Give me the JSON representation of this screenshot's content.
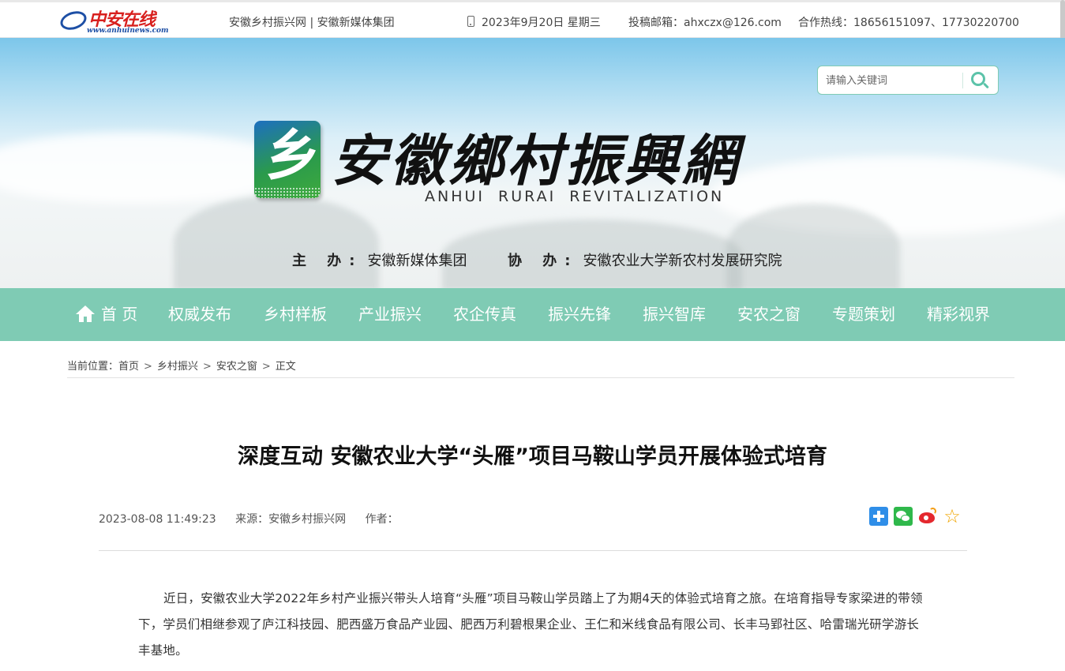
{
  "topbar": {
    "logo_brand": "中安在线",
    "logo_url": "www.anhuinews.com",
    "site_links": "安徽乡村振兴网 | 安徽新媒体集团",
    "date": "2023年9月20日 星期三",
    "email": "投稿邮箱：ahxczx@126.com",
    "hotline": "合作热线：18656151097、17730220700"
  },
  "banner": {
    "emblem_glyph": "乡",
    "title": "安徽鄉村振興網",
    "subtitle": "ANHUI RURAI REVITALIZATION",
    "host_label": "主 办:",
    "host_value": "安徽新媒体集团",
    "co_label": "协 办:",
    "co_value": "安徽农业大学新农村发展研究院",
    "search_placeholder": "请输入关键词"
  },
  "nav": {
    "items": [
      "首 页",
      "权威发布",
      "乡村样板",
      "产业振兴",
      "农企传真",
      "振兴先锋",
      "振兴智库",
      "安农之窗",
      "专题策划",
      "精彩视界"
    ]
  },
  "breadcrumb": {
    "label": "当前位置：",
    "items": [
      "首页",
      "乡村振兴",
      "安农之窗",
      "正文"
    ]
  },
  "article": {
    "title": "深度互动 安徽农业大学“头雁”项目马鞍山学员开展体验式培育",
    "datetime": "2023-08-08 11:49:23",
    "source": "来源：安徽乡村振兴网",
    "author": "作者：",
    "share_icons": [
      "share-plus-icon",
      "wechat-icon",
      "weibo-icon",
      "favorite-star-icon"
    ],
    "paragraph": "近日，安徽农业大学2022年乡村产业振兴带头人培育“头雁”项目马鞍山学员踏上了为期4天的体验式培育之旅。在培育指导专家梁进的带领下，学员们相继参观了庐江科技园、肥西盛万食品产业园、肥西万利碧根果企业、王仁和米线食品有限公司、长丰马郢社区、哈雷瑞光研学游长丰基地。"
  },
  "colors": {
    "nav_bg": "#7fcbb4",
    "accent": "#5cc3a9",
    "brand_red": "#d8201e"
  }
}
